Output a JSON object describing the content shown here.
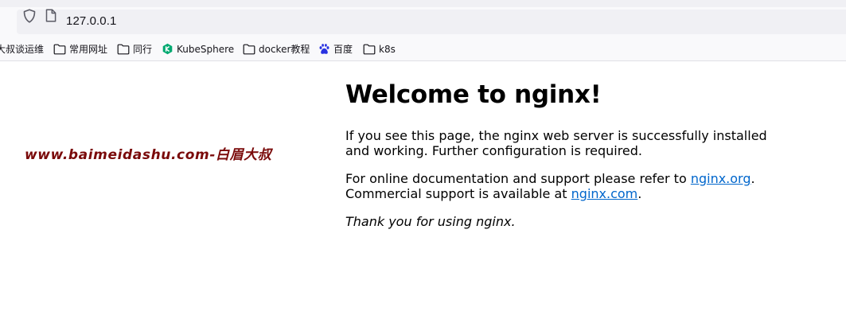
{
  "browser": {
    "url": "127.0.0.1",
    "bookmarks": [
      {
        "label": "大叔谈运维",
        "icon": "none"
      },
      {
        "label": "常用网址",
        "icon": "folder-icon"
      },
      {
        "label": "同行",
        "icon": "folder-icon"
      },
      {
        "label": "KubeSphere",
        "icon": "kubesphere-icon"
      },
      {
        "label": "docker教程",
        "icon": "folder-icon"
      },
      {
        "label": "百度",
        "icon": "baidu-icon"
      },
      {
        "label": "k8s",
        "icon": "folder-icon"
      }
    ]
  },
  "page": {
    "watermark": "www.baimeidashu.com-白眉大叔",
    "title": "Welcome to nginx!",
    "p1": "If you see this page, the nginx web server is successfully installed and working. Further configuration is required.",
    "p2_pre": "For online documentation and support please refer to ",
    "p2_link1": "nginx.org",
    "p2_mid": ".",
    "p2_pre2": "Commercial support is available at ",
    "p2_link2": "nginx.com",
    "p2_end": ".",
    "p3": "Thank you for using nginx."
  },
  "colors": {
    "link": "#0066cc",
    "watermark": "#7a0a0a",
    "kubesphere": "#00a971",
    "baidu": "#2932e1"
  }
}
